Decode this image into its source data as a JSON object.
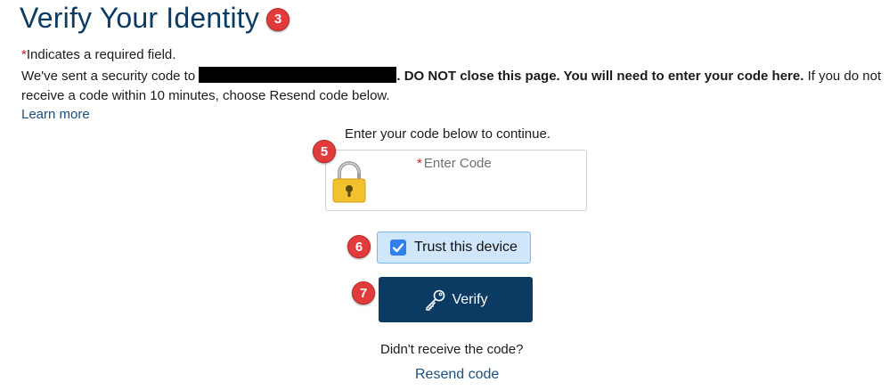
{
  "header": {
    "title": "Verify Your Identity",
    "step_badge": "3"
  },
  "required_note": {
    "star": "*",
    "text": "Indicates a required field."
  },
  "info": {
    "prefix": "We've sent a security code to ",
    "bold_text": ". DO NOT close this page. You will need to enter your code here.",
    "suffix": " If you do not receive a code within 10 minutes, choose Resend code below."
  },
  "learn_more_label": "Learn more",
  "code_entry": {
    "prompt": "Enter your code below to continue.",
    "star": "*",
    "placeholder": "Enter Code",
    "step_badge": "5",
    "icon": "lock-icon"
  },
  "trust_device": {
    "label": "Trust this device",
    "checked": true,
    "step_badge": "6"
  },
  "verify_button": {
    "label": "Verify",
    "icon": "key-icon",
    "step_badge": "7"
  },
  "resend": {
    "question": "Didn't receive the code?",
    "link_label": "Resend code"
  },
  "colors": {
    "title": "#0b3a63",
    "primary_button": "#0b3a63",
    "badge": "#e23b3b",
    "trust_bg": "#cfe6fb",
    "checkbox": "#2f80ed",
    "link": "#1a4f80"
  }
}
